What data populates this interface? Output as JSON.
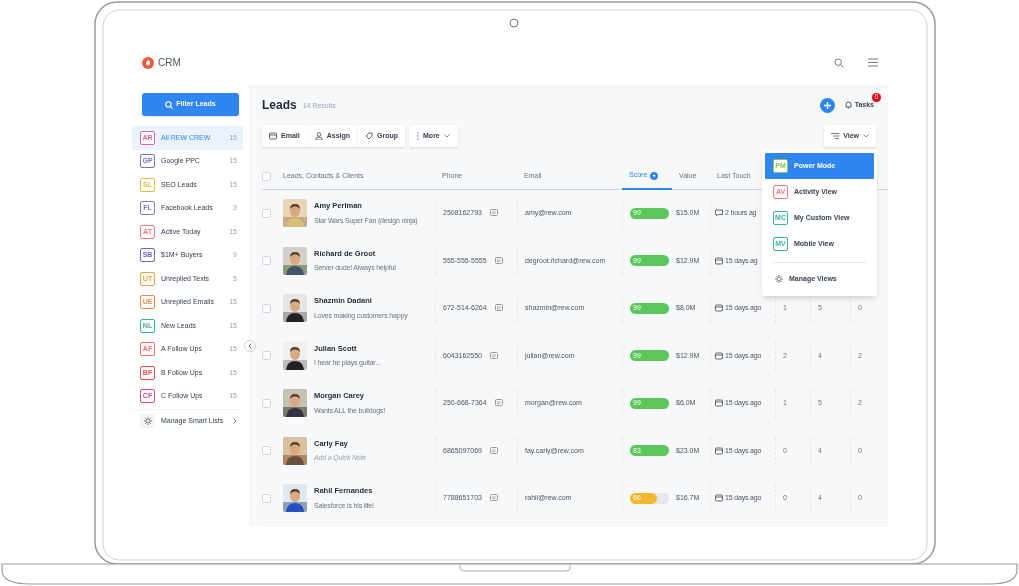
{
  "app": {
    "title": "CRM"
  },
  "sidebar": {
    "filter_button": "Filter Leads",
    "items": [
      {
        "badge": "AR",
        "label": "All REW CREW",
        "count": "15",
        "selected": true,
        "color": "#e2629a"
      },
      {
        "badge": "GP",
        "label": "Google PPC",
        "count": "15",
        "selected": false,
        "color": "#7b6fc4"
      },
      {
        "badge": "SL",
        "label": "SEO Leads",
        "count": "15",
        "selected": false,
        "color": "#e8b93a"
      },
      {
        "badge": "FL",
        "label": "Facebook Leads",
        "count": "3",
        "selected": false,
        "color": "#8a72c8"
      },
      {
        "badge": "AT",
        "label": "Active Today",
        "count": "15",
        "selected": false,
        "color": "#ef7b7b"
      },
      {
        "badge": "SB",
        "label": "$1M+ Buyers",
        "count": "9",
        "selected": false,
        "color": "#6f67c2"
      },
      {
        "badge": "UT",
        "label": "Unreplied Texts",
        "count": "5",
        "selected": false,
        "color": "#f0a040"
      },
      {
        "badge": "UE",
        "label": "Unreplied Emails",
        "count": "15",
        "selected": false,
        "color": "#f08a4b"
      },
      {
        "badge": "NL",
        "label": "New Leads",
        "count": "15",
        "selected": false,
        "color": "#3bb38a"
      },
      {
        "badge": "AF",
        "label": "A Follow Ups",
        "count": "15",
        "selected": false,
        "color": "#f06d6d"
      },
      {
        "badge": "BF",
        "label": "B Follow Ups",
        "count": "15",
        "selected": false,
        "color": "#e35050"
      },
      {
        "badge": "CF",
        "label": "C Follow Ups",
        "count": "15",
        "selected": false,
        "color": "#e0467c"
      }
    ],
    "manage": "Manage Smart Lists"
  },
  "header": {
    "title": "Leads",
    "results": "14 Results",
    "tasks": "Tasks",
    "tasks_badge": "0"
  },
  "toolbar": {
    "actions": [
      {
        "kind": "mail",
        "label": "Email"
      },
      {
        "kind": "person",
        "label": "Assign"
      },
      {
        "kind": "tag",
        "label": "Group"
      }
    ],
    "more": "More",
    "view": "View"
  },
  "table": {
    "columns": [
      {
        "label": "Leads, Contacts & Clients",
        "selected": false
      },
      {
        "label": "Phone",
        "selected": false
      },
      {
        "label": "Email",
        "selected": false
      },
      {
        "label": "Score",
        "selected": true
      },
      {
        "label": "Value",
        "selected": false
      },
      {
        "label": "Last Touch",
        "selected": false
      }
    ],
    "select_all_checked": false,
    "rows": [
      {
        "name": "Amy Perlman",
        "note": "Star Wars Super Fan (design ninja)",
        "note_placeholder": false,
        "checked": false,
        "phone": "2508162793",
        "email": "amy@rew.com",
        "score": "99",
        "level": 0.99,
        "color": "#5cc85c",
        "value": "$15.0M",
        "kind": "chat",
        "last_touch": "2 hours ag"
      },
      {
        "name": "Richard de Groot",
        "note": "Server dude! Always helpful",
        "note_placeholder": false,
        "checked": false,
        "phone": "555-555-5555",
        "email": "degroot.richard@rew.com",
        "score": "99",
        "level": 0.99,
        "color": "#5cc85c",
        "value": "$12.9M",
        "kind": "mail",
        "last_touch": "15 days ag"
      },
      {
        "name": "Shazmin Dadani",
        "note": "Loves making customers happy",
        "note_placeholder": false,
        "checked": false,
        "phone": "672-514-6264",
        "email": "shazmin@rew.com",
        "score": "99",
        "level": 0.99,
        "color": "#5cc85c",
        "value": "$8.0M",
        "kind": "mail",
        "last_touch": "15 days ago",
        "column_7": "1",
        "column_8": "5",
        "column_9": "0"
      },
      {
        "name": "Julian Scott",
        "note": "I hear he plays guitar...",
        "note_placeholder": false,
        "checked": false,
        "phone": "6043162550",
        "email": "julian@rew.com",
        "score": "99",
        "level": 0.99,
        "color": "#5cc85c",
        "value": "$12.9M",
        "kind": "mail",
        "last_touch": "15 days ago",
        "column_7": "2",
        "column_8": "4",
        "column_9": "2"
      },
      {
        "name": "Morgan Carey",
        "note": "Wants ALL the bulldogs!",
        "note_placeholder": false,
        "checked": false,
        "phone": "250-668-7364",
        "email": "morgan@rew.com",
        "score": "99",
        "level": 0.99,
        "color": "#5cc85c",
        "value": "$6.0M",
        "kind": "mail",
        "last_touch": "15 days ago",
        "column_7": "1",
        "column_8": "5",
        "column_9": "2"
      },
      {
        "name": "Carly Fay",
        "note": "Add a Quick Note",
        "note_placeholder": true,
        "checked": false,
        "phone": "6865097069",
        "email": "fay.carly@rew.com",
        "score": "83",
        "level": 1.0,
        "color": "#5cc85c",
        "value": "$23.0M",
        "kind": "mail",
        "last_touch": "15 days ago",
        "column_7": "0",
        "column_8": "4",
        "column_9": "0"
      },
      {
        "name": "Rahil Fernandes",
        "note": "Salesforce is his life!",
        "note_placeholder": false,
        "checked": false,
        "phone": "7788651703",
        "email": "rahil@rew.com",
        "score": "66",
        "level": 0.7,
        "color": "#f4b731",
        "value": "$16.7M",
        "kind": "mail",
        "last_touch": "15 days ago",
        "column_7": "0",
        "column_8": "4",
        "column_9": "0"
      }
    ]
  },
  "view_menu": {
    "items": [
      {
        "badge": "PM",
        "label": "Power Mode",
        "selected": true,
        "color": "#8cc152"
      },
      {
        "badge": "AV",
        "label": "Activity View",
        "selected": false,
        "color": "#ef7b7b"
      },
      {
        "badge": "MC",
        "label": "My Custom View",
        "selected": false,
        "color": "#3bb3a8"
      },
      {
        "badge": "MV",
        "label": "Mobile View",
        "selected": false,
        "color": "#3bb3a8"
      }
    ],
    "manage": "Manage Views"
  }
}
